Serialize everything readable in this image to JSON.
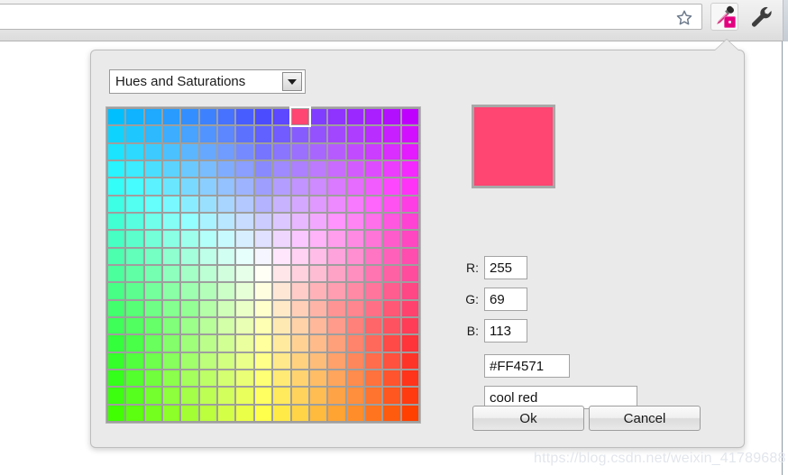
{
  "browser": {
    "omnibox_value": "",
    "omnibox_placeholder": "",
    "bookmark_icon": "star-icon",
    "extension_icon": "eyedropper-icon",
    "menu_icon": "wrench-icon",
    "extension_badge_color": "#E2007F"
  },
  "popup": {
    "mode_select": {
      "selected": "Hues and Saturations",
      "options": [
        "Hues and Saturations"
      ],
      "caret_icon": "chevron-down-icon"
    },
    "preview": {
      "color": "#FF4571"
    },
    "fields": {
      "r_label": "R:",
      "r_value": "255",
      "g_label": "G:",
      "g_value": "69",
      "b_label": "B:",
      "b_value": "113",
      "hex_value": "#FF4571",
      "name_value": "cool red"
    },
    "buttons": {
      "ok": "Ok",
      "cancel": "Cancel"
    },
    "palette": {
      "columns": 17,
      "rows": 18,
      "selected_col": 10,
      "selected_row": 0,
      "selected_hex": "#FF4571",
      "gap_color": "#9E9E9E"
    }
  },
  "watermark": {
    "text": "https://blog.csdn.net/weixin_41789688"
  }
}
